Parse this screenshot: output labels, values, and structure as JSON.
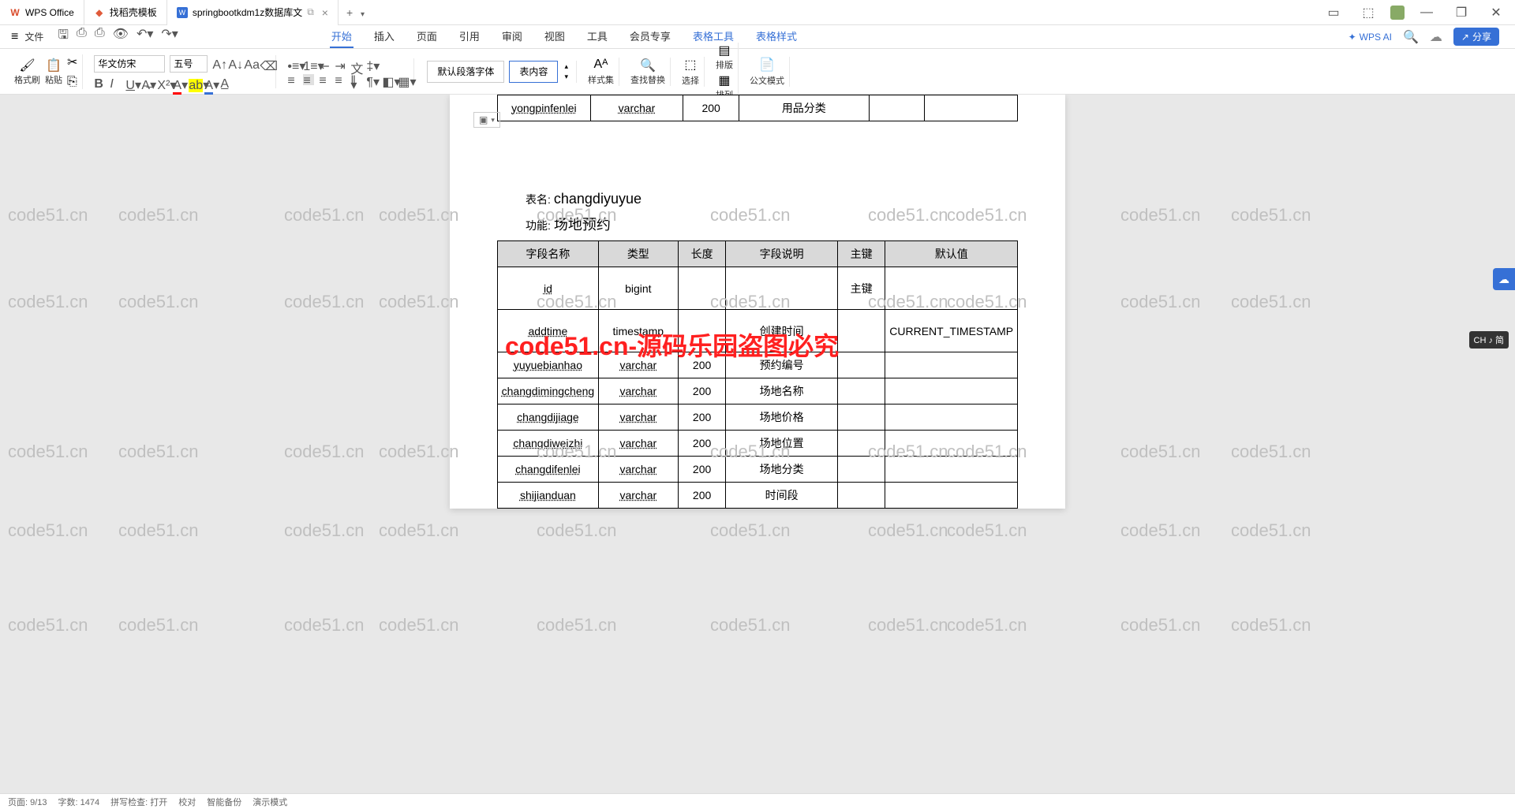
{
  "app": {
    "name": "WPS Office"
  },
  "tabs": [
    {
      "icon": "wps",
      "label": "WPS Office"
    },
    {
      "icon": "template",
      "label": "找稻壳模板"
    },
    {
      "icon": "doc",
      "label": "springbootkdm1z数据库文",
      "active": true
    }
  ],
  "titleButtons": {
    "add": "+",
    "dropdown": "▾"
  },
  "winControls": {
    "min": "—",
    "max": "❐",
    "close": "✕"
  },
  "fileMenu": {
    "hamburger": "≡",
    "label": "文件"
  },
  "menuTabs": [
    "开始",
    "插入",
    "页面",
    "引用",
    "审阅",
    "视图",
    "工具",
    "会员专享"
  ],
  "menuTabsExtra": [
    "表格工具",
    "表格样式"
  ],
  "wpsAI": "WPS AI",
  "shareBtn": "分享",
  "ribbon": {
    "formatBrush": "格式刷",
    "paste": "粘贴",
    "font": "华文仿宋",
    "size": "五号",
    "styleDefault": "默认段落字体",
    "styleBody": "表内容",
    "styleSet": "样式集",
    "findReplace": "查找替换",
    "select": "选择",
    "layout": "排版",
    "arrange": "排列",
    "officialDoc": "公文模式"
  },
  "pageHandle": "▣",
  "topTable": {
    "rows": [
      {
        "field": "yongpinfenlei",
        "type": "varchar",
        "len": "200",
        "desc": "用品分类",
        "pk": "",
        "def": ""
      }
    ]
  },
  "tableNameLabel": "表名:",
  "tableName": "changdiyuyue",
  "funcLabel": "功能:",
  "funcName": "场地预约",
  "headers": {
    "field": "字段名称",
    "type": "类型",
    "len": "长度",
    "desc": "字段说明",
    "pk": "主键",
    "def": "默认值"
  },
  "mainTable": {
    "rows": [
      {
        "field": "id",
        "type": "bigint",
        "len": "",
        "desc": "",
        "pk": "主键",
        "def": ""
      },
      {
        "field": "addtime",
        "type": "timestamp",
        "len": "",
        "desc": "创建时间",
        "pk": "",
        "def": "CURRENT_TIMESTAMP"
      },
      {
        "field": "yuyuebianhao",
        "type": "varchar",
        "len": "200",
        "desc": "预约编号",
        "pk": "",
        "def": ""
      },
      {
        "field": "changdimingcheng",
        "type": "varchar",
        "len": "200",
        "desc": "场地名称",
        "pk": "",
        "def": ""
      },
      {
        "field": "changdijiage",
        "type": "varchar",
        "len": "200",
        "desc": "场地价格",
        "pk": "",
        "def": ""
      },
      {
        "field": "changdiweizhi",
        "type": "varchar",
        "len": "200",
        "desc": "场地位置",
        "pk": "",
        "def": ""
      },
      {
        "field": "changdifenlei",
        "type": "varchar",
        "len": "200",
        "desc": "场地分类",
        "pk": "",
        "def": ""
      },
      {
        "field": "shijianduan",
        "type": "varchar",
        "len": "200",
        "desc": "时间段",
        "pk": "",
        "def": ""
      }
    ]
  },
  "redWatermark": "code51.cn-源码乐园盗图必究",
  "greyWatermark": "code51.cn",
  "statusBar": {
    "page": "页面: 9/13",
    "words": "字数: 1474",
    "spell": "拼写检查: 打开",
    "proof": "校对",
    "backup": "智能备份",
    "readMode": "演示模式"
  },
  "imeBadge": "CH ♪ 简",
  "sideWidget": "☁"
}
